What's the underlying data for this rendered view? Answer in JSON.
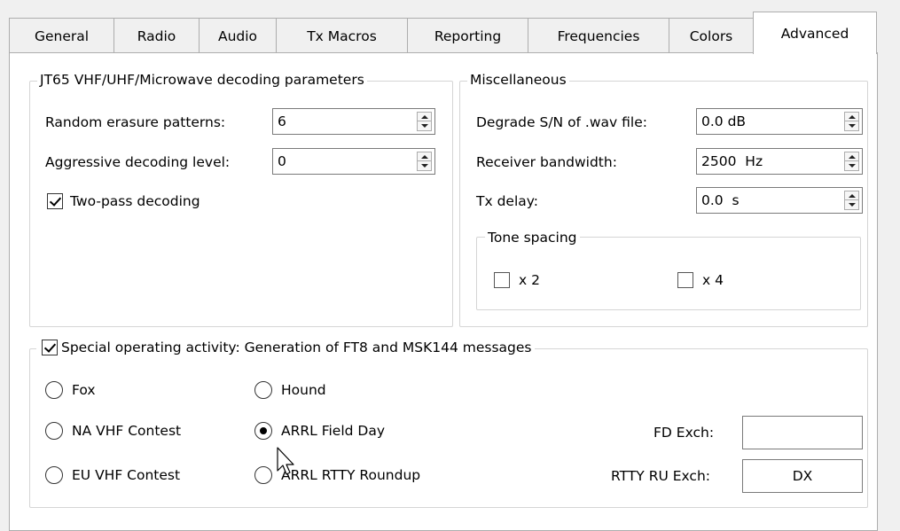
{
  "tabs": [
    "General",
    "Radio",
    "Audio",
    "Tx Macros",
    "Reporting",
    "Frequencies",
    "Colors",
    "Advanced"
  ],
  "active_tab": "Advanced",
  "jt65_group": {
    "title": "JT65 VHF/UHF/Microwave decoding parameters",
    "random_erasure": {
      "label": "Random erasure patterns:",
      "value": "6"
    },
    "aggressive_level": {
      "label": "Aggressive decoding level:",
      "value": "0"
    },
    "two_pass": {
      "label": "Two-pass decoding",
      "checked": true
    }
  },
  "misc_group": {
    "title": "Miscellaneous",
    "degrade": {
      "label": "Degrade S/N of .wav file:",
      "value": "0.0 dB"
    },
    "bandwidth": {
      "label": "Receiver bandwidth:",
      "value": "2500  Hz"
    },
    "tx_delay": {
      "label": "Tx delay:",
      "value": "0.0  s"
    },
    "tone_spacing": {
      "title": "Tone spacing",
      "x2": {
        "label": "x 2",
        "checked": false
      },
      "x4": {
        "label": "x 4",
        "checked": false
      }
    }
  },
  "special_group": {
    "title": "Special operating activity:  Generation of FT8 and MSK144 messages",
    "checked": true,
    "options": {
      "fox": "Fox",
      "hound": "Hound",
      "na_vhf": "NA VHF Contest",
      "arrl_fd": "ARRL Field Day",
      "eu_vhf": "EU VHF Contest",
      "arrl_rtty": "ARRL RTTY Roundup"
    },
    "selected": "ARRL Field Day",
    "fd_exch": {
      "label": "FD Exch:",
      "value": ""
    },
    "rtty_ru_exch": {
      "label": "RTTY RU Exch:",
      "value": "DX"
    }
  },
  "icons": {
    "spin": "spin-up-down-icon",
    "cursor": "mouse-pointer-icon"
  }
}
